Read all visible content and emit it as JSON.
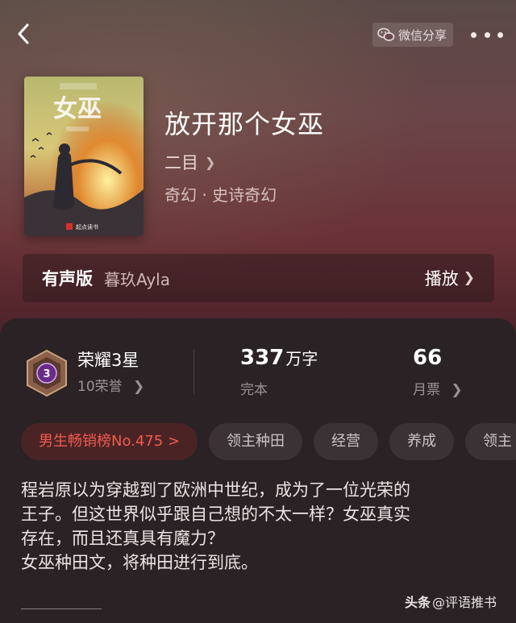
{
  "header": {
    "share_label": "微信分享",
    "back_icon": "chevron-left-icon",
    "share_icon": "wechat-icon",
    "more_icon": "more-dots-icon"
  },
  "book": {
    "title": "放开那个女巫",
    "author": "二目",
    "genre": "奇幻 · 史诗奇幻",
    "cover": {
      "title_text": "女巫",
      "publisher": "起点读书"
    }
  },
  "audio": {
    "label": "有声版",
    "narrator": "暮玖Ayla",
    "play_label": "播放"
  },
  "stats": {
    "honor_title": "荣耀3星",
    "honor_level": "3",
    "honor_sub": "10荣誉",
    "words_value": "337",
    "words_unit": "万字",
    "words_sub": "完本",
    "votes_value": "66",
    "votes_sub": "月票"
  },
  "tags": [
    "男生畅销榜No.475 >",
    "领主种田",
    "经营",
    "养成",
    "领主"
  ],
  "description": [
    "程岩原以为穿越到了欧洲中世纪，成为了一位光荣的",
    "王子。但这世界似乎跟自己想的不太一样？女巫真实",
    "存在，而且还真具有魔力？",
    "女巫种田文，将种田进行到底。"
  ],
  "watermark": {
    "logo": "头条",
    "text": "@评语推书"
  },
  "colors": {
    "accent_red": "#f05a50",
    "panel_bg": "#2a2224",
    "medal_purple": "#6a2a8a"
  }
}
